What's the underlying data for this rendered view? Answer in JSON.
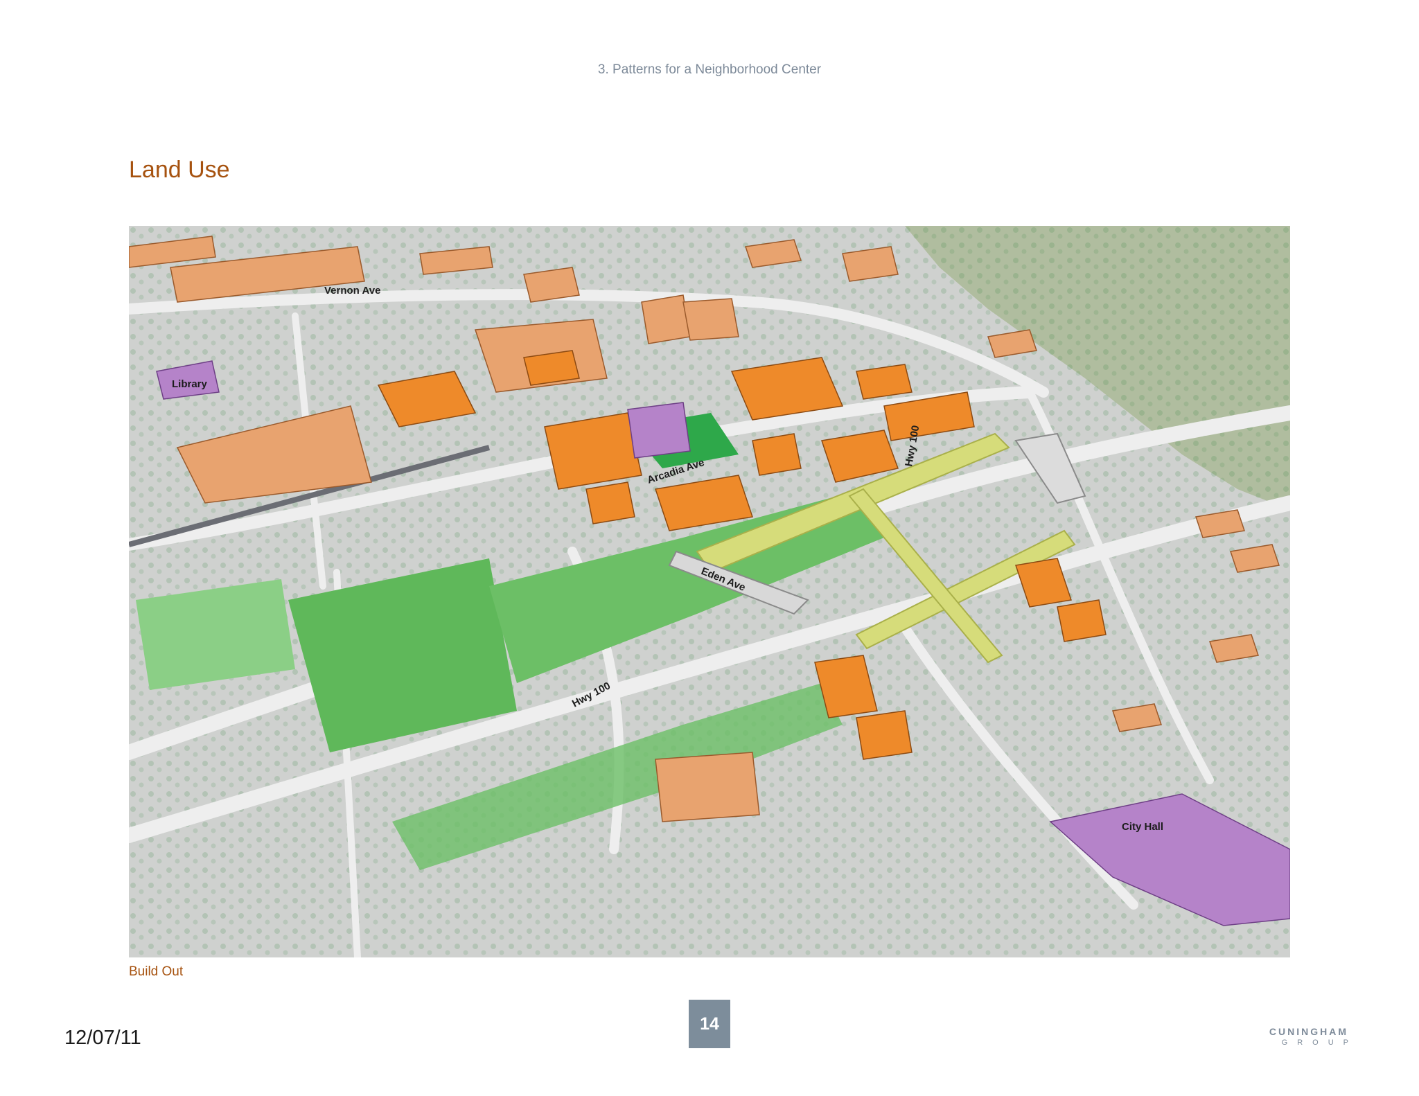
{
  "header": {
    "running_title": "3. Patterns for a Neighborhood Center"
  },
  "section": {
    "title": "Land Use"
  },
  "figure": {
    "caption": "Build Out",
    "labels": {
      "vernon_ave": "Vernon Ave",
      "library": "Library",
      "arcadia_ave": "Arcadia Ave",
      "hwy_100_vertical": "Hwy 100",
      "eden_ave": "Eden Ave",
      "hwy_100_diagonal": "Hwy 100",
      "city_hall": "City Hall"
    },
    "colors": {
      "ground": "#cfd1cf",
      "open_space": "#5fb85a",
      "existing_building": "#e8a36f",
      "new_building": "#ee8a2a",
      "civic": "#b583c9",
      "trail": "#d6dc7a",
      "water": "#b0bd9f"
    }
  },
  "footer": {
    "date": "12/07/11",
    "page_number": "14",
    "logo_line1": "CUNINGHAM",
    "logo_line2": "GROUP"
  }
}
